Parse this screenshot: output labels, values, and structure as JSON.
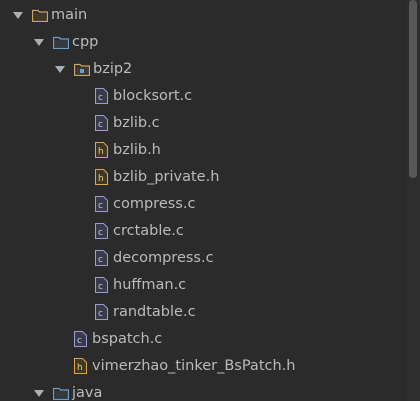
{
  "tree": {
    "main": {
      "label": "main",
      "icon": "folder-icon"
    },
    "cpp": {
      "label": "cpp",
      "icon": "folder-icon"
    },
    "bzip2": {
      "label": "bzip2",
      "icon": "package-folder-icon"
    },
    "files": [
      {
        "label": "blocksort.c",
        "type": "c"
      },
      {
        "label": "bzlib.c",
        "type": "c"
      },
      {
        "label": "bzlib.h",
        "type": "h"
      },
      {
        "label": "bzlib_private.h",
        "type": "h"
      },
      {
        "label": "compress.c",
        "type": "c"
      },
      {
        "label": "crctable.c",
        "type": "c"
      },
      {
        "label": "decompress.c",
        "type": "c"
      },
      {
        "label": "huffman.c",
        "type": "c"
      },
      {
        "label": "randtable.c",
        "type": "c"
      }
    ],
    "cpp_files": [
      {
        "label": "bspatch.c",
        "type": "c"
      },
      {
        "label": "vimerzhao_tinker_BsPatch.h",
        "type": "h"
      }
    ],
    "java": {
      "label": "java",
      "icon": "folder-icon"
    }
  },
  "colors": {
    "background": "#2b2b2b",
    "text": "#bbbbbb",
    "main_folder": "#c9a56a",
    "source_folder": "#6b9fc9",
    "c_file": "#9a9cd6",
    "h_file": "#d9a84d"
  }
}
